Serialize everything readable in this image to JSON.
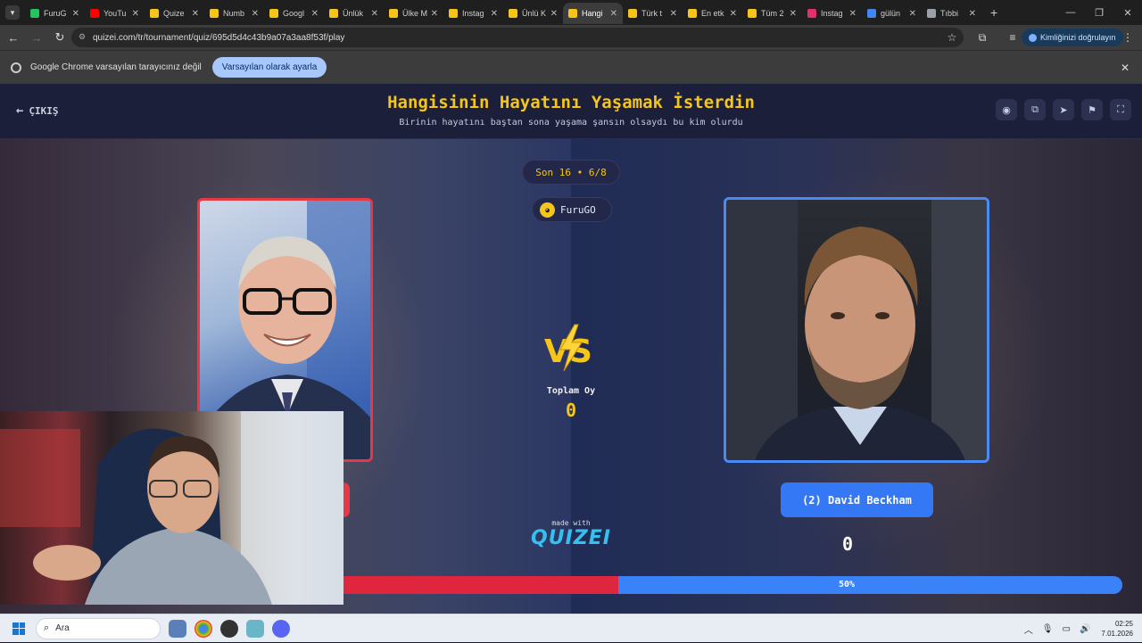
{
  "browser": {
    "tabs": [
      {
        "label": "FuruG",
        "color": "#22c55e"
      },
      {
        "label": "YouTu",
        "color": "#ff0000"
      },
      {
        "label": "Quize",
        "color": "#f5c518"
      },
      {
        "label": "Numb",
        "color": "#f5c518"
      },
      {
        "label": "Googl",
        "color": "#f5c518"
      },
      {
        "label": "Ünlük",
        "color": "#f5c518"
      },
      {
        "label": "Ülke M",
        "color": "#f5c518"
      },
      {
        "label": "Instag",
        "color": "#f5c518"
      },
      {
        "label": "Ünlü K",
        "color": "#f5c518"
      },
      {
        "label": "Hangi",
        "color": "#f5c518",
        "active": true
      },
      {
        "label": "Türk t",
        "color": "#f5c518"
      },
      {
        "label": "En etk",
        "color": "#f5c518"
      },
      {
        "label": "Tüm 2",
        "color": "#f5c518"
      },
      {
        "label": "Instag",
        "color": "#e1306c"
      },
      {
        "label": "gülün",
        "color": "#4285f4"
      },
      {
        "label": "Tıbbi",
        "color": "#9aa0a6"
      }
    ],
    "url": "quizei.com/tr/tournament/quiz/695d5d4c43b9a07a3aa8f53f/play",
    "verify_label": "Kimliğinizi doğrulayın",
    "infobar_text": "Google Chrome varsayılan tarayıcınız değil",
    "infobar_button": "Varsayılan olarak ayarla"
  },
  "quiz": {
    "exit_label": "ÇIKIŞ",
    "title": "Hangisinin Hayatını Yaşamak İsterdin",
    "subtitle": "Birinin hayatını baştan sona yaşama şansın olsaydı bu kim olurdu",
    "round": "Son 16 • 6/8",
    "user": "FuruGO",
    "total_label": "Toplam Oy",
    "total_value": "0",
    "right_choice": "(2) David Beckham",
    "right_score": "0",
    "made_with": "made with",
    "brand": "QUIZEI",
    "progress_label": "50%",
    "left_share": 0.5,
    "colors": {
      "left": "#e53946",
      "right": "#3478f6",
      "accent": "#f5c518"
    }
  },
  "taskbar": {
    "search_placeholder": "Ara",
    "time": "02:25",
    "date": "7.01.2026"
  }
}
